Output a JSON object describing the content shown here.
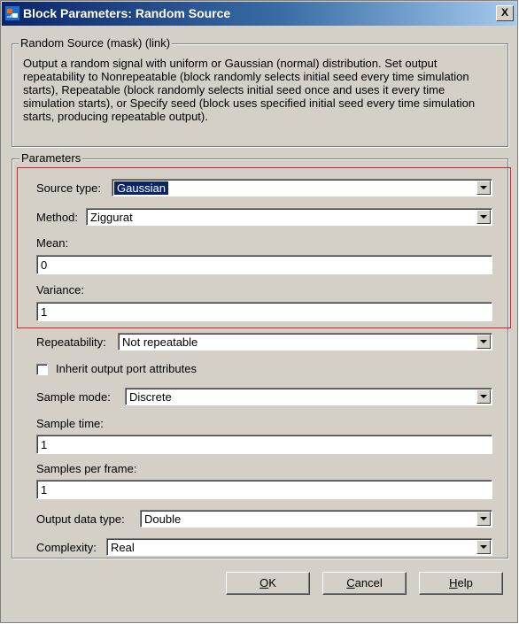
{
  "window": {
    "title": "Block Parameters: Random Source",
    "close_label": "X"
  },
  "mask_group": {
    "legend": "Random Source (mask) (link)",
    "description": "Output a random signal with uniform or Gaussian (normal) distribution.  Set output repeatability to Nonrepeatable (block randomly selects initial seed every time simulation starts), Repeatable (block randomly selects initial seed once and uses it every time simulation starts), or Specify seed (block uses specified initial seed every time simulation starts, producing repeatable output)."
  },
  "params": {
    "legend": "Parameters",
    "source_type": {
      "label": "Source type:",
      "value": "Gaussian"
    },
    "method": {
      "label": "Method:",
      "value": "Ziggurat"
    },
    "mean": {
      "label": "Mean:",
      "value": "0"
    },
    "variance": {
      "label": "Variance:",
      "value": "1"
    },
    "repeatability": {
      "label": "Repeatability:",
      "value": "Not repeatable"
    },
    "inherit": {
      "label": "Inherit output port attributes",
      "checked": false
    },
    "sample_mode": {
      "label": "Sample mode:",
      "value": "Discrete"
    },
    "sample_time": {
      "label": "Sample time:",
      "value": "1"
    },
    "samples_per_frame": {
      "label": "Samples per frame:",
      "value": "1"
    },
    "output_data_type": {
      "label": "Output data type:",
      "value": "Double"
    },
    "complexity": {
      "label": "Complexity:",
      "value": "Real"
    }
  },
  "buttons": {
    "ok_mn": "O",
    "ok_rest": "K",
    "cancel_mn": "C",
    "cancel_rest": "ancel",
    "help_mn": "H",
    "help_rest": "elp"
  },
  "colors": {
    "highlight": "#e02020",
    "titlebar": "#0a246a",
    "face": "#d4d0c8"
  }
}
